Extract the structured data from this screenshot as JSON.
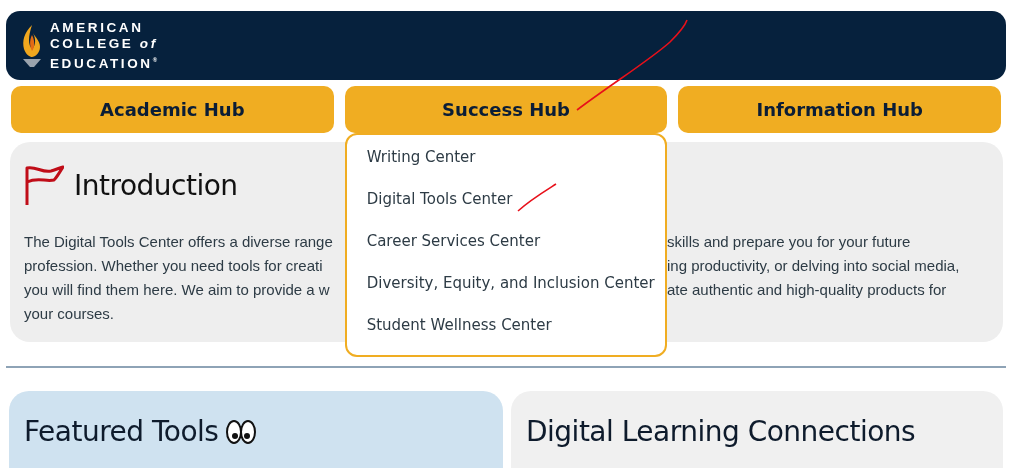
{
  "header": {
    "logo_lines": [
      "AMERICAN",
      "COLLEGE *of*",
      "EDUCATION$^{®}$"
    ]
  },
  "hubs": [
    {
      "label": "Academic Hub",
      "expanded": false
    },
    {
      "label": "Success Hub",
      "expanded": true,
      "menu": [
        "Writing Center",
        "Digital Tools Center",
        "Career Services Center",
        "Diversity, Equity, and Inclusion Center",
        "Student Wellness Center"
      ]
    },
    {
      "label": "Information Hub",
      "expanded": false
    }
  ],
  "introduction": {
    "title": "Introduction",
    "text_left": [
      "The Digital Tools Center offers a diverse range",
      "profession. Whether you need tools for creati",
      "you will find them here. We aim to provide a w",
      "your courses."
    ],
    "text_right": [
      "skills and prepare you for your future",
      "ing productivity, or delving into social media,",
      "ate authentic and high-quality products for"
    ]
  },
  "cards": [
    {
      "title": "Featured Tools",
      "kind": "featured"
    },
    {
      "title": "Digital Learning Connections",
      "kind": "plain"
    }
  ]
}
